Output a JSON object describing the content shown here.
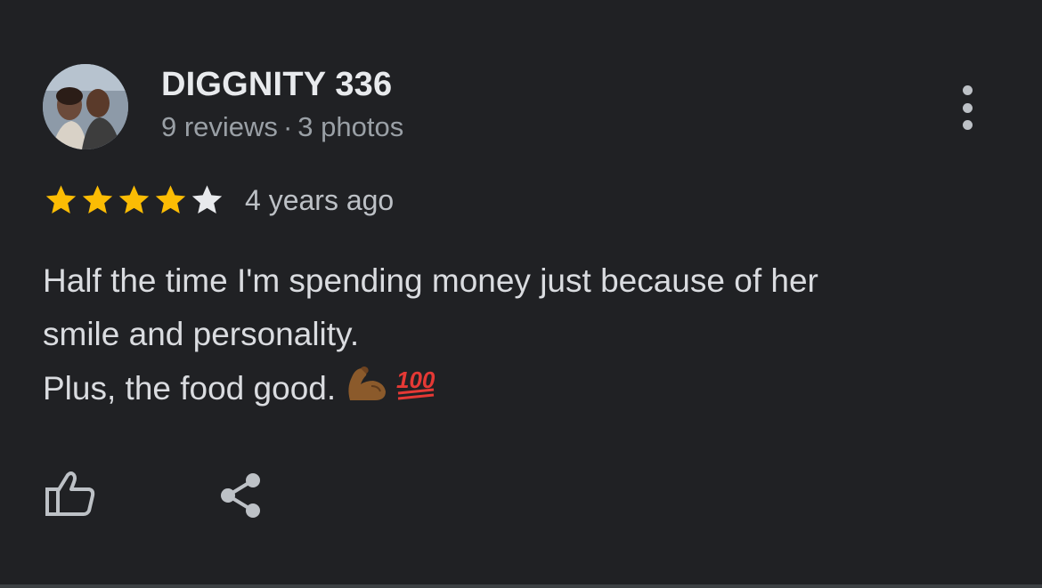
{
  "review": {
    "author": {
      "name": "DIGGNITY 336",
      "reviews_count": "9 reviews",
      "separator": "·",
      "photos_count": "3 photos"
    },
    "rating": 4,
    "rating_max": 5,
    "date": "4 years ago",
    "text_lines": [
      "Half the time I'm spending money just because of her",
      "smile and personality.",
      "Plus, the food good."
    ],
    "emojis": [
      "flexed-biceps-emoji",
      "hundred-points-emoji"
    ],
    "actions": {
      "like_icon": "thumbs-up-icon",
      "share_icon": "share-icon",
      "more_icon": "more-vert-icon"
    }
  },
  "colors": {
    "background": "#202124",
    "star_filled": "#fbbc04",
    "star_empty": "#e8eaed",
    "text_primary": "#e8eaed",
    "text_secondary": "#9aa0a6"
  }
}
